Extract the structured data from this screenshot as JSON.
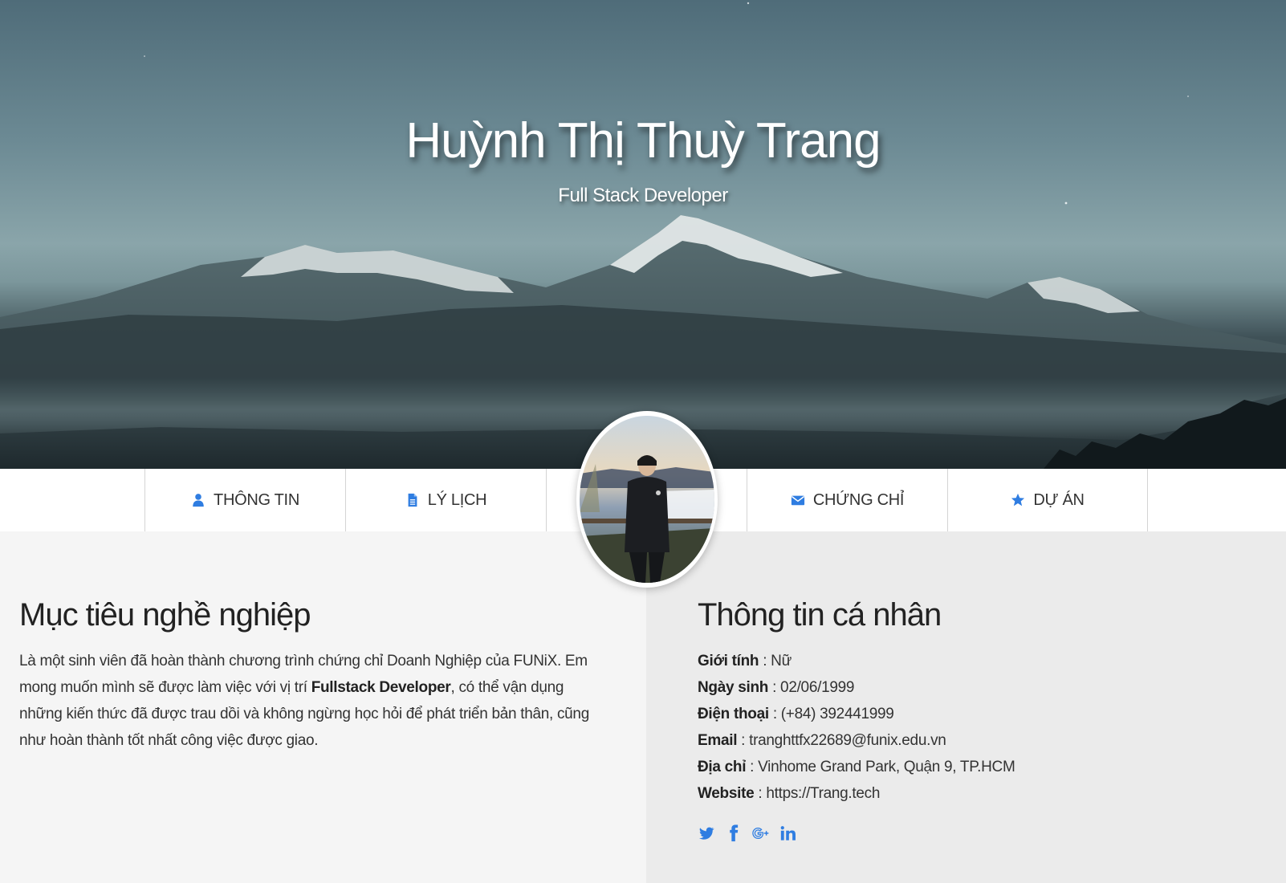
{
  "hero": {
    "name": "Huỳnh Thị Thuỳ Trang",
    "role": "Full Stack Developer"
  },
  "nav": {
    "items": [
      {
        "label": "THÔNG TIN",
        "icon": "user-icon"
      },
      {
        "label": "LÝ LỊCH",
        "icon": "document-icon"
      },
      {
        "label": "CHỨNG CHỈ",
        "icon": "envelope-icon"
      },
      {
        "label": "DỰ ÁN",
        "icon": "star-icon"
      }
    ]
  },
  "objective": {
    "title": "Mục tiêu nghề nghiệp",
    "text_before": "Là một sinh viên đã hoàn thành chương trình chứng chỉ Doanh Nghiệp của FUNiX. Em mong muốn mình sẽ được làm việc với vị trí ",
    "highlight": "Fullstack Developer",
    "text_after": ", có thể vận dụng những kiến thức đã được trau dồi và không ngừng học hỏi để phát triển bản thân, cũng như hoàn thành tốt nhất công việc được giao."
  },
  "personal": {
    "title": "Thông tin cá nhân",
    "rows": [
      {
        "label": "Giới tính",
        "value": " : Nữ"
      },
      {
        "label": "Ngày sinh",
        "value": " : 02/06/1999"
      },
      {
        "label": "Điện thoại",
        "value": " : (+84) 392441999"
      },
      {
        "label": "Email",
        "value": " : tranghttfx22689@funix.edu.vn"
      },
      {
        "label": "Địa chỉ",
        "value": " : Vinhome Grand Park, Quận 9, TP.HCM"
      },
      {
        "label": "Website",
        "value": " : https://Trang.tech"
      }
    ]
  },
  "socials": [
    "twitter-icon",
    "facebook-icon",
    "google-plus-icon",
    "linkedin-icon"
  ],
  "colors": {
    "accent": "#2f7de1",
    "left_bg": "#f5f5f5",
    "right_bg": "#ebebeb"
  }
}
